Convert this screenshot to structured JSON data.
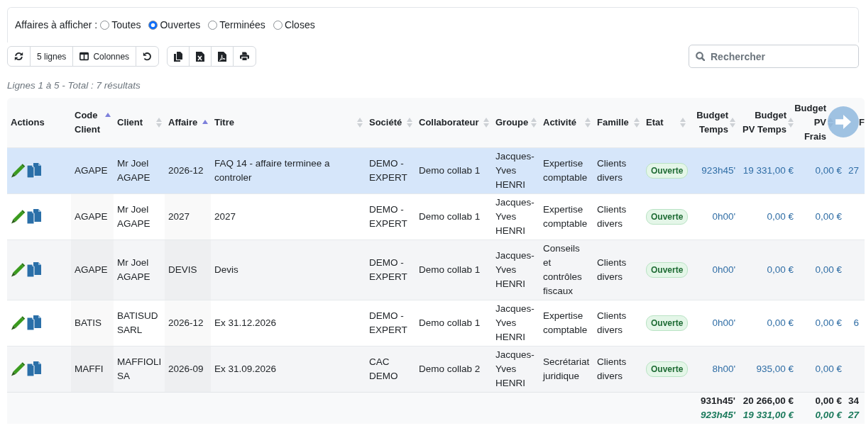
{
  "filter": {
    "label": "Affaires à afficher :",
    "options": [
      {
        "label": "Toutes",
        "selected": false
      },
      {
        "label": "Ouvertes",
        "selected": true
      },
      {
        "label": "Terminées",
        "selected": false
      },
      {
        "label": "Closes",
        "selected": false
      }
    ]
  },
  "toolbar": {
    "groups": [
      [
        {
          "kind": "refresh"
        },
        {
          "kind": "page_size",
          "label": "5 lignes"
        },
        {
          "kind": "columns",
          "label": "Colonnes"
        },
        {
          "kind": "reset"
        }
      ],
      [
        {
          "kind": "copy"
        },
        {
          "kind": "excel"
        },
        {
          "kind": "pdf"
        },
        {
          "kind": "print"
        }
      ]
    ]
  },
  "search": {
    "placeholder": "Rechercher"
  },
  "summary": "Lignes 1 à 5 - Total : 7 résultats",
  "table": {
    "actions_column": {
      "label": "Actions"
    },
    "columns": [
      {
        "label": "Code Client",
        "kind": "text",
        "sortable": true,
        "sorted": true
      },
      {
        "label": "Client",
        "kind": "text",
        "sortable": true,
        "sorted": false
      },
      {
        "label": "Affaire",
        "kind": "text",
        "sortable": true,
        "sorted": true
      },
      {
        "label": "Titre",
        "kind": "text",
        "sortable": true,
        "sorted": false
      },
      {
        "label": "Société",
        "kind": "text",
        "sortable": true,
        "sorted": false
      },
      {
        "label": "Collaborateur",
        "kind": "text",
        "sortable": true,
        "sorted": false
      },
      {
        "label": "Groupe",
        "kind": "text",
        "sortable": true,
        "sorted": false
      },
      {
        "label": "Activité",
        "kind": "text",
        "sortable": true,
        "sorted": false
      },
      {
        "label": "Famille",
        "kind": "text",
        "sortable": true,
        "sorted": false
      },
      {
        "label": "Etat",
        "kind": "status",
        "sortable": true,
        "sorted": false
      },
      {
        "label": "Budget Temps",
        "kind": "number",
        "sortable": true,
        "sorted": false,
        "total": "931h45'",
        "subtotal": "923h45'"
      },
      {
        "label": "Budget PV Temps",
        "kind": "number",
        "sortable": true,
        "sorted": false,
        "total": "20 266,00 €",
        "subtotal": "19 331,00 €"
      },
      {
        "label": "Budget PV Frais",
        "kind": "number",
        "sortable": true,
        "sorted": false,
        "total": "0,00 €",
        "subtotal": "0,00 €"
      },
      {
        "label": "F",
        "kind": "number",
        "sortable": false,
        "total": "34",
        "subtotal": "27"
      }
    ],
    "rows": [
      {
        "selected": true,
        "cells": [
          "AGAPE",
          "Mr Joel AGAPE",
          "2026-12",
          "FAQ 14 - affaire terminee a controler",
          "DEMO - EXPERT",
          "Demo collab 1",
          "Jacques-Yves HENRI",
          "Expertise comptable",
          "Clients divers",
          "Ouverte",
          "923h45'",
          "19 331,00 €",
          "0,00 €",
          "27"
        ]
      },
      {
        "selected": false,
        "cells": [
          "AGAPE",
          "Mr Joel AGAPE",
          "2027",
          "2027",
          "DEMO - EXPERT",
          "Demo collab 1",
          "Jacques-Yves HENRI",
          "Expertise comptable",
          "Clients divers",
          "Ouverte",
          "0h00'",
          "0,00 €",
          "0,00 €",
          null
        ]
      },
      {
        "selected": false,
        "cells": [
          "AGAPE",
          "Mr Joel AGAPE",
          "DEVIS",
          "Devis",
          "DEMO - EXPERT",
          "Demo collab 1",
          "Jacques-Yves HENRI",
          "Conseils et contrôles fiscaux",
          "Clients divers",
          "Ouverte",
          "0h00'",
          "0,00 €",
          "0,00 €",
          null
        ]
      },
      {
        "selected": false,
        "cells": [
          "BATIS",
          "BATISUD SARL",
          "2026-12",
          "Ex 31.12.2026",
          "DEMO - EXPERT",
          "Demo collab 1",
          "Jacques-Yves HENRI",
          "Expertise comptable",
          "Clients divers",
          "Ouverte",
          "0h00'",
          "0,00 €",
          "0,00 €",
          "6"
        ]
      },
      {
        "selected": false,
        "cells": [
          "MAFFI",
          "MAFFIOLI SA",
          "2026-09",
          "Ex 31.09.2026",
          "CAC DEMO",
          "Demo collab 2",
          "Jacques-Yves HENRI",
          "Secrétariat juridique",
          "Clients divers",
          "Ouverte",
          "8h00'",
          "935,00 €",
          "0,00 €",
          null
        ]
      }
    ]
  }
}
